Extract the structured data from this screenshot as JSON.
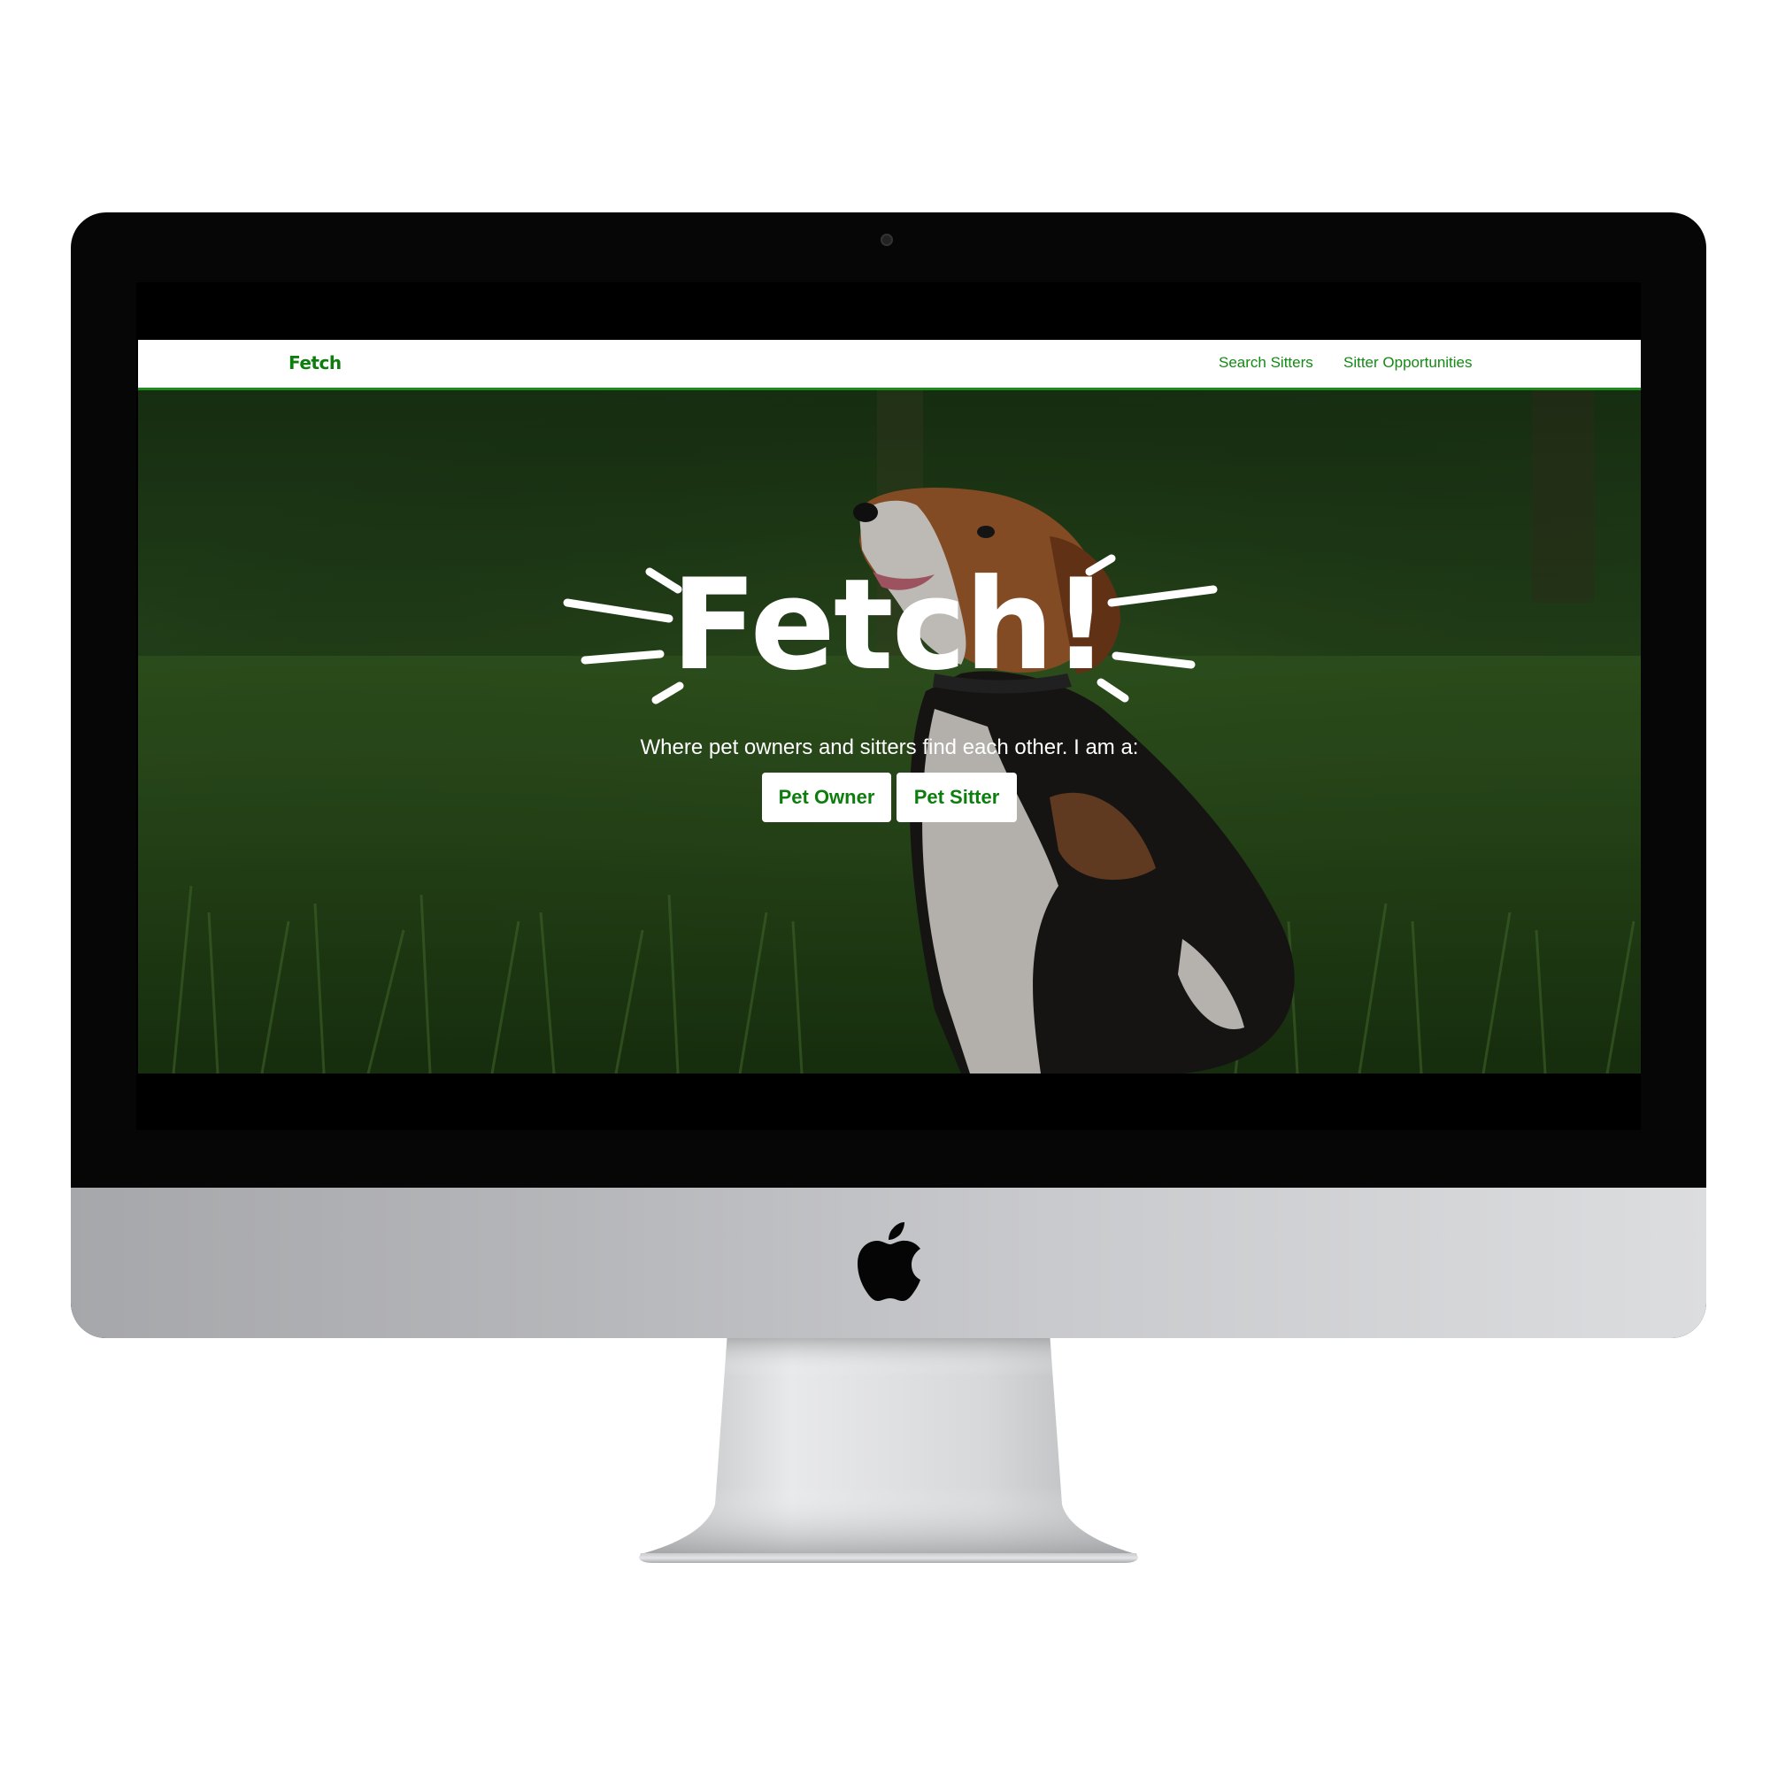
{
  "navbar": {
    "brand": "Fetch",
    "links": [
      {
        "label": "Search Sitters"
      },
      {
        "label": "Sitter Opportunities"
      }
    ],
    "accent_color": "#0d7d0d"
  },
  "hero": {
    "title": "Fetch!",
    "subtitle": "Where pet owners and sitters find each other. I am a:",
    "buttons": [
      {
        "label": "Pet Owner"
      },
      {
        "label": "Pet Sitter"
      }
    ],
    "background": "dog-in-grass-photo"
  },
  "device": {
    "type": "imac-mockup",
    "logo": "apple-icon"
  }
}
